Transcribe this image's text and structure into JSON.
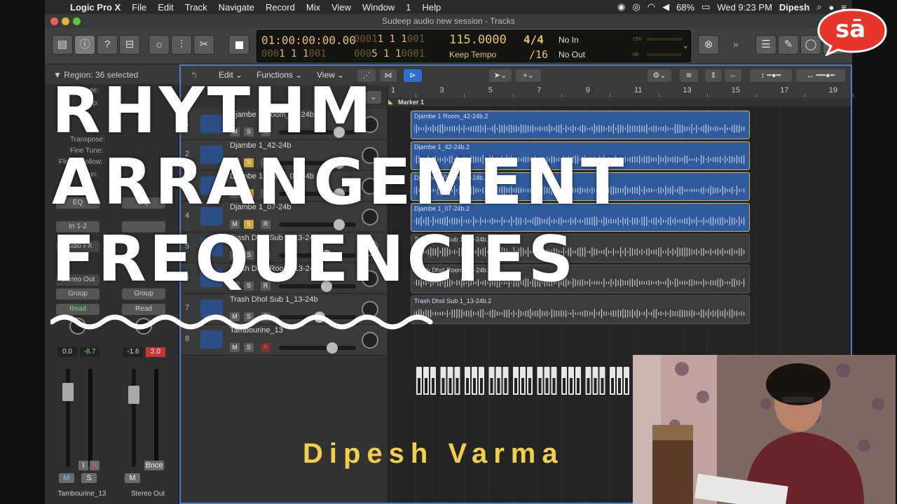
{
  "menubar": {
    "app": "Logic Pro X",
    "items": [
      "File",
      "Edit",
      "Track",
      "Navigate",
      "Record",
      "Mix",
      "View",
      "Window",
      "1",
      "Help"
    ],
    "battery": "68%",
    "clock": "Wed 9:23 PM",
    "user": "Dipesh"
  },
  "window": {
    "title": "Sudeep audio new session - Tracks"
  },
  "lcd": {
    "time": "01:00:00:00.00",
    "bars": "1  1  1",
    "bars_dim": "001",
    "bars2": "1  1  1",
    "bars2_dim": "001",
    "bars3": "5  1  1",
    "bars3_dim": "0001",
    "tempo": "115.0000",
    "tempo_label": "Keep Tempo",
    "sig": "4/4",
    "div": "/16",
    "in": "No In",
    "out": "No Out",
    "cpu": "CPU",
    "hd": "HD"
  },
  "inspector": {
    "region_header": "Region: 36 selected",
    "labels": [
      "Mute:",
      "Loop:",
      "Transpose:",
      "Fine Tune:",
      "Flex & Follow:",
      "Gain:"
    ],
    "strip_left": {
      "slots": [
        "EQ",
        "In 1-2",
        "Audio FX",
        "Stereo Out",
        "Group",
        "Read"
      ],
      "pan": "0.0",
      "peak": "-8.7",
      "name": "Tambourine_13",
      "m": "M",
      "s": "S",
      "i": "I",
      "r": "R"
    },
    "strip_right": {
      "slots": [
        "EQ",
        "",
        "",
        "",
        "Group",
        "Read"
      ],
      "pan": "-1.6",
      "peak": "2.0",
      "name": "Stereo Out",
      "m": "M",
      "bnce": "Bnce"
    }
  },
  "toolbar": {
    "edit": "Edit",
    "functions": "Functions",
    "view": "View"
  },
  "ruler": {
    "marks": [
      "1",
      "3",
      "5",
      "7",
      "9",
      "11",
      "13",
      "15",
      "17",
      "19"
    ],
    "marker": "Marker 1"
  },
  "tracks": [
    {
      "num": "1",
      "name": "Djambe 1 Room_42-24b",
      "solo": false
    },
    {
      "num": "2",
      "name": "Djambe 1_42-24b",
      "solo": true
    },
    {
      "num": "3",
      "name": "Djambe 1 Room_07-24b",
      "solo": true
    },
    {
      "num": "4",
      "name": "Djambe 1_07-24b",
      "solo": true
    },
    {
      "num": "5",
      "name": "Trash Dhol Sub 1_13-24b",
      "solo": false
    },
    {
      "num": "6",
      "name": "Trash Dhol Room_13-24b",
      "solo": false
    },
    {
      "num": "7",
      "name": "Trash Dhol Sub 1_13-24b",
      "solo": false
    },
    {
      "num": "8",
      "name": "Tambourine_13",
      "solo": false
    }
  ],
  "regions": [
    {
      "name": "Djambe 1 Room_42-24b.2",
      "selected": true
    },
    {
      "name": "Djambe 1_42-24b.2",
      "selected": true
    },
    {
      "name": "Djambe 1 Room_07-24b.2",
      "selected": true
    },
    {
      "name": "Djambe 1_07-24b.2",
      "selected": true
    },
    {
      "name": "Trash Dhol Sub 1_13-24b.2",
      "selected": false
    },
    {
      "name": "Trash Dhol Room_13-24b.2",
      "selected": false
    },
    {
      "name": "Trash Dhol Sub 1_13-24b.2",
      "selected": false
    }
  ],
  "overlay": {
    "line1": "RHYTHM",
    "line2": "ARRANGEMENT",
    "line3": "FREQUENCIES",
    "credit": "Dipesh Varma",
    "badge": "sā"
  },
  "colors": {
    "accent": "#4d80c9",
    "region": "#2f5b9e",
    "title": "#ffffff",
    "credit": "#f2d04c",
    "badge": "#e8352b"
  }
}
